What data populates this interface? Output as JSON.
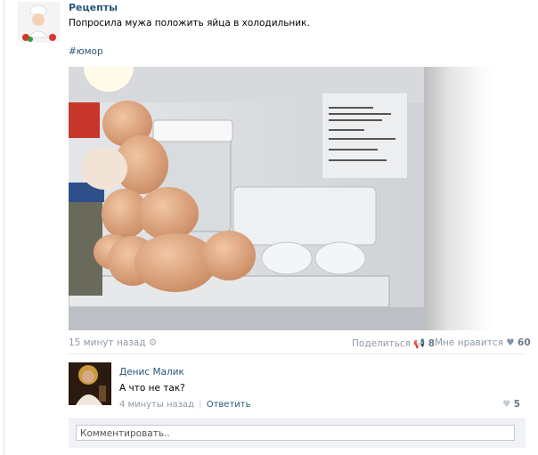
{
  "post": {
    "author": "Рецепты",
    "text": "Попросила мужа положить яйца в холодильник.",
    "hashtag": "#юмор",
    "time": "15 минут назад",
    "share_label": "Поделиться",
    "share_count": "8",
    "like_label": "Мне нравится",
    "like_count": "60"
  },
  "comment": {
    "author": "Денис Малик",
    "text": "А что не так?",
    "time": "4 минуты назад",
    "separator": "|",
    "reply_label": "Ответить",
    "likes": "5"
  },
  "reply": {
    "placeholder": "Комментировать.."
  },
  "colors": {
    "link": "#2b587a",
    "muted": "#8f99a6"
  }
}
